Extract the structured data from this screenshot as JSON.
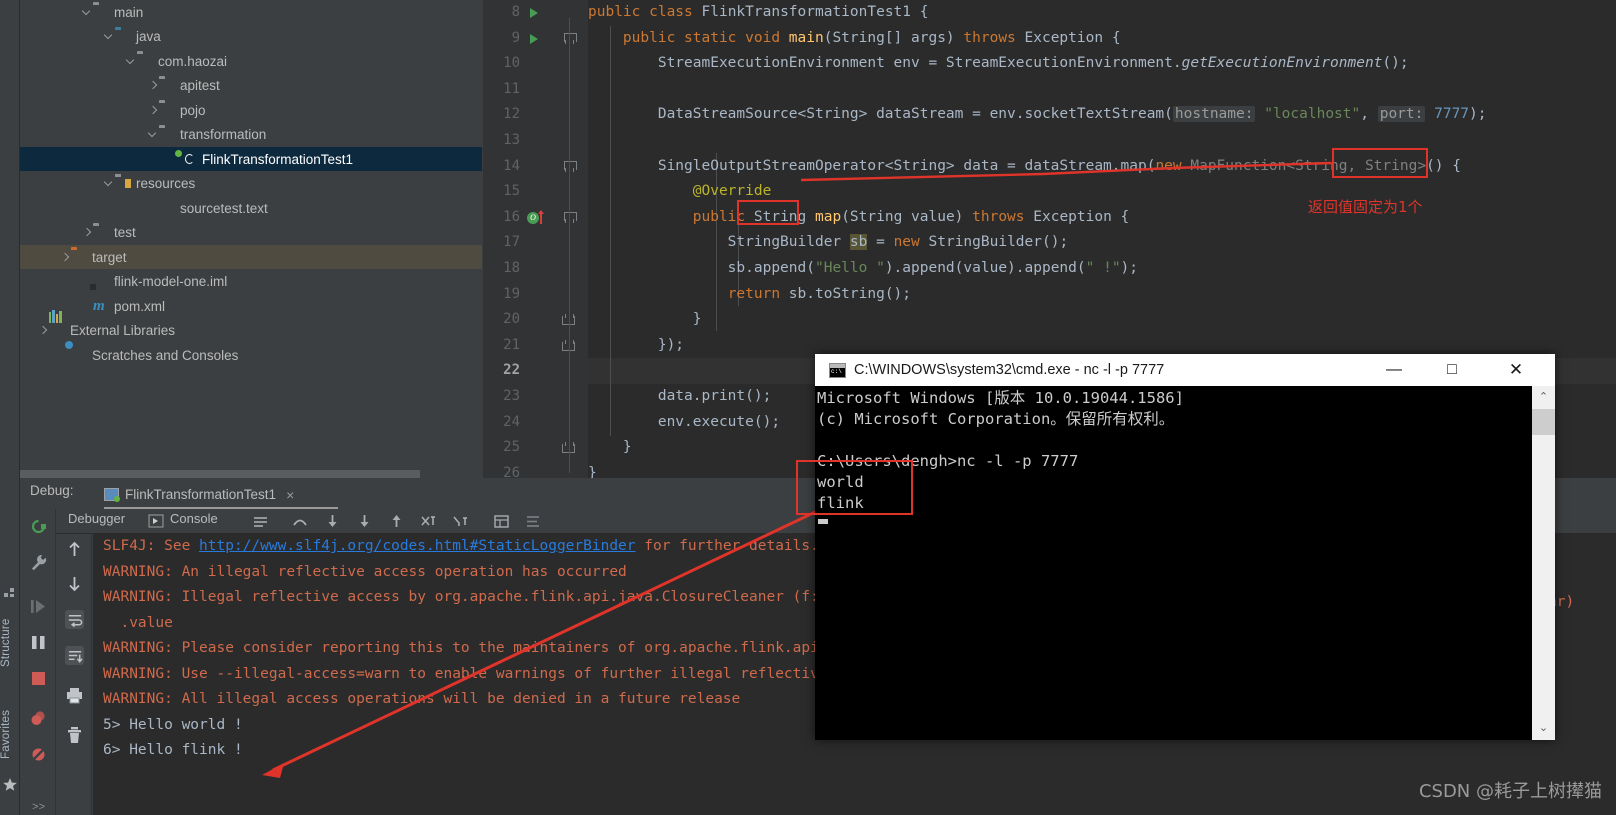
{
  "sidebar_tabs": {
    "structure": "Structure",
    "favorites": "Favorites"
  },
  "project_tree": [
    {
      "label": "main",
      "indent": 60,
      "arrow": "down",
      "icon": "folder-gray"
    },
    {
      "label": "java",
      "indent": 82,
      "arrow": "down",
      "icon": "folder-blue"
    },
    {
      "label": "com.haozai",
      "indent": 104,
      "arrow": "down",
      "icon": "package"
    },
    {
      "label": "apitest",
      "indent": 126,
      "arrow": "right",
      "icon": "package"
    },
    {
      "label": "pojo",
      "indent": 126,
      "arrow": "right",
      "icon": "package"
    },
    {
      "label": "transformation",
      "indent": 126,
      "arrow": "down",
      "icon": "package"
    },
    {
      "label": "FlinkTransformationTest1",
      "indent": 148,
      "arrow": "none",
      "icon": "class",
      "selected": true
    },
    {
      "label": "resources",
      "indent": 82,
      "arrow": "down",
      "icon": "folder-resources"
    },
    {
      "label": "sourcetest.text",
      "indent": 126,
      "arrow": "none",
      "icon": "text-file"
    },
    {
      "label": "test",
      "indent": 60,
      "arrow": "right",
      "icon": "folder-gray"
    },
    {
      "label": "target",
      "indent": 38,
      "arrow": "right",
      "icon": "folder-orange",
      "highlight": true
    },
    {
      "label": "flink-model-one.iml",
      "indent": 60,
      "arrow": "none",
      "icon": "iml-file"
    },
    {
      "label": "pom.xml",
      "indent": 60,
      "arrow": "none",
      "icon": "maven"
    },
    {
      "label": "External Libraries",
      "indent": 16,
      "arrow": "right",
      "icon": "libraries"
    },
    {
      "label": "Scratches and Consoles",
      "indent": 38,
      "arrow": "none",
      "icon": "scratches"
    }
  ],
  "editor": {
    "lines": [
      {
        "num": 8,
        "run": true,
        "fold": "none"
      },
      {
        "num": 9,
        "run": true,
        "fold": "open"
      },
      {
        "num": 10,
        "fold": "none"
      },
      {
        "num": 11,
        "fold": "none"
      },
      {
        "num": 12,
        "fold": "none"
      },
      {
        "num": 13,
        "fold": "none"
      },
      {
        "num": 14,
        "fold": "open"
      },
      {
        "num": 15,
        "fold": "none"
      },
      {
        "num": 16,
        "fold": "open",
        "override": true
      },
      {
        "num": 17,
        "fold": "none"
      },
      {
        "num": 18,
        "fold": "none"
      },
      {
        "num": 19,
        "fold": "none"
      },
      {
        "num": 20,
        "fold": "close"
      },
      {
        "num": 21,
        "fold": "close"
      },
      {
        "num": 22,
        "fold": "none",
        "current": true
      },
      {
        "num": 23,
        "fold": "none"
      },
      {
        "num": 24,
        "fold": "none"
      },
      {
        "num": 25,
        "fold": "close"
      },
      {
        "num": 26,
        "fold": "none"
      }
    ],
    "annotation_text": "返回值固定为1个",
    "param_hint_hostname": "hostname:",
    "param_hint_port": "port:"
  },
  "debug_panel": {
    "label": "Debug:",
    "tab_title": "FlinkTransformationTest1",
    "tab_close": "×",
    "debugger_tab": "Debugger",
    "console_tab": "Console",
    "console_lines": [
      "SLF4J: See http://www.slf4j.org/codes.html#StaticLoggerBinder for further details.",
      "WARNING: An illegal reflective access operation has occurred",
      "WARNING: Illegal reflective access by org.apache.flink.api.java.ClosureCleaner (f:",
      "  .value",
      "WARNING: Please consider reporting this to the maintainers of org.apache.flink.api",
      "WARNING: Use --illegal-access=warn to enable warnings of further illegal reflectiv",
      "WARNING: All illegal access operations will be denied in a future release",
      "5> Hello world !",
      "6> Hello flink !"
    ],
    "link_text": "http://www.slf4j.org/codes.html#StaticLoggerBinder",
    "clipped_right": "ar)"
  },
  "cmd_window": {
    "title": "C:\\WINDOWS\\system32\\cmd.exe - nc  -l -p 7777",
    "minimize": "—",
    "maximize": "□",
    "close": "✕",
    "scroll_up": "⌃",
    "scroll_down": "⌄",
    "lines": [
      "Microsoft Windows [版本 10.0.19044.1586]",
      "(c) Microsoft Corporation。保留所有权利。",
      "",
      "C:\\Users\\dengh>nc -l -p 7777",
      "world",
      "flink"
    ]
  },
  "watermark": "CSDN @耗子上树撵猫",
  "colors": {
    "editor_bg": "#2b2b2b",
    "panel_bg": "#3c3f41",
    "selection_blue": "#0d293e",
    "annotation_red": "#e0342a",
    "keyword_orange": "#cc7832",
    "string_green": "#6a8759",
    "number_blue": "#6897bb",
    "console_red": "#cf6a4c"
  }
}
